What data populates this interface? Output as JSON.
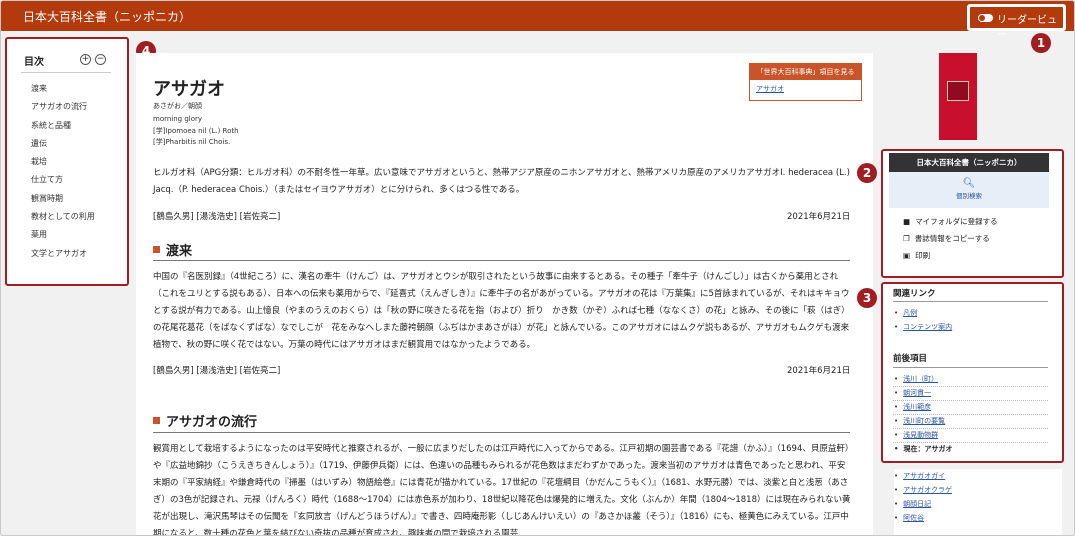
{
  "app": {
    "title": "日本大百科全書（ニッポニカ）",
    "reader_label": "リーダービュー"
  },
  "markers": [
    "1",
    "2",
    "3",
    "4"
  ],
  "toc": {
    "heading": "目次",
    "plus": "+",
    "minus": "−",
    "items": [
      "渡来",
      "アサガオの流行",
      "系統と品種",
      "遺伝",
      "栽培",
      "仕立て方",
      "観賞時期",
      "教材としての利用",
      "薬用",
      "文学とアサガオ"
    ]
  },
  "article": {
    "title": "アサガオ",
    "reading": "あさがお／朝顔",
    "english": "morning glory",
    "sci1": "[学]Ipomoea nil (L.) Roth",
    "sci2": "[学]Pharbitis nil Chois.",
    "see_box": {
      "header": "「世界大百科事典」項目を見る",
      "link": "アサガオ"
    },
    "intro": "ヒルガオ科（APG分類：ヒルガオ科）の不耐冬性一年草。広い意味でアサガオというと、熱帯アジア原産のニホンアサガオと、熱帯アメリカ原産のアメリカアサガオI. hederacea (L.) Jacq.（P. hederacea Chois.）（またはセイヨウアサガオ）とに分けられ、多くはつる性である。",
    "authors": "[鶴島久男]  [湯浅浩史]  [岩佐亮二]",
    "date": "2021年6月21日",
    "sec1_title": "渡来",
    "sec1_text": "中国の『名医別録』（4世紀ころ）に、漢名の牽牛（けんご）は、アサガオとウシが取引されたという故事に由来するとある。その種子「牽牛子（けんごし）」は古くから薬用とされ（これをユリとする説もある）、日本への伝来も薬用からで、『延喜式（えんぎしき）』に牽牛子の名があがっている。アサガオの花は『万葉集』に5首詠まれているが、それはキキョウとする説が有力である。山上憶良（やまのうえのおくら）は「秋の野に咲きたる花を指（および）折り　かき数（かぞ）ふれば七種（ななくさ）の花」と詠み、その後に「萩（はぎ）の花尾花葛花（をばなくずばな）なでしこが　花をみなへしまた藤袴朝顔（ふぢはかまあさがほ）が花」と詠んでいる。このアサガオにはムクゲ説もあるが、アサガオもムクゲも渡来植物で、秋の野に咲く花ではない。万葉の時代にはアサガオはまだ観賞用ではなかったようである。",
    "sec1_authors": "[鶴島久男]  [湯浅浩史]  [岩佐亮二]",
    "sec1_date": "2021年6月21日",
    "sec2_title": "アサガオの流行",
    "sec2_text": "観賞用として栽培するようになったのは平安時代と推察されるが、一般に広まりだしたのは江戸時代に入ってからである。江戸初期の園芸書である『花譜（かふ）』（1694、貝原益軒）や『広益地錦抄（こうえきちきんしょう）』（1719、伊藤伊兵衛）には、色違いの品種もみられるが花色数はまだわずかであった。渡来当初のアサガオは青色であったと思われ、平安末期の『平家納経』や鎌倉時代の『掃墨（はいずみ）物語絵巻』には青花が描かれている。17世紀の『花壇綱目（かだんこうもく）』（1681、水野元勝）では、淡紫と白と浅葱（あさぎ）の3色が記録され、元禄（げんろく）時代（1688～1704）には赤色系が加わり、18世紀以降花色は爆発的に増えた。文化（ぶんか）年間（1804～1818）には現在みられない黄花が出現し、滝沢馬琴はその伝聞を『玄同放言（げんどうほうげん）』で書き、四時庵形影（しじあんけいえい）の『あさかほ叢（そう）』（1816）にも、極黄色にみえている。江戸中期になると、数十種の花色と葉を結びない奇抜の品種が育成され、趣味者の間で栽培される園芸"
  },
  "sidebar": {
    "panel_title": "日本大百科全書（ニッポニカ）",
    "search_label": "個別検索",
    "actions": [
      "マイフォルダに登録する",
      "書誌情報をコピーする",
      "印刷"
    ],
    "related_heading": "関連リンク",
    "related_links": [
      "凡例",
      "コンテンツ案内"
    ],
    "nav_heading": "前後項目",
    "nav_items": [
      "浅川（町）",
      "朝河貫一",
      "浅川範彦",
      "浅川町の要覧",
      "浅見動物群"
    ],
    "current": "現在：アサガオ",
    "after_items": [
      "アサガオガイ",
      "アサガオクラゲ",
      "朝顔日記",
      "阿佐谷"
    ]
  }
}
